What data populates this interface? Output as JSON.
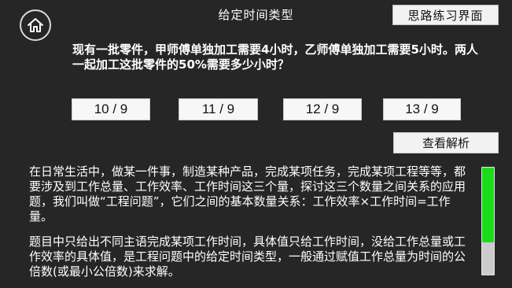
{
  "header": {
    "title": "给定时间类型",
    "mode_button_label": "思路练习界面",
    "home_icon": "home-icon"
  },
  "question": {
    "text": "现有一批零件，甲师傅单独加工需要4小时，乙师傅单独加工需要5小时。两人一起加工这批零件的50%需要多少小时？"
  },
  "options": [
    "10 / 9",
    "11 / 9",
    "12 / 9",
    "13 / 9"
  ],
  "analysis_button_label": "查看解析",
  "explanation": {
    "paragraph_1": "在日常生活中，做某一件事，制造某种产品，完成某项任务，完成某项工程等等，都要涉及到工作总量、工作效率、工作时间这三个量，探讨这三个数量之间关系的应用题，我们叫做“工程问题”，它们之间的基本数量关系：工作效率×工作时间=工作量。",
    "paragraph_2": "题目中只给出不同主语完成某项工作时间，具体值只给工作时间，没给工作总量或工作效率的具体值，是工程问题中的给定时间类型，一般通过赋值工作总量为时间的公倍数(或最小公倍数)来求解。"
  },
  "scrollbar": {
    "position_fraction": 0.7,
    "thumb_color": "#1bdc1b",
    "track_color": "#cccccc"
  }
}
